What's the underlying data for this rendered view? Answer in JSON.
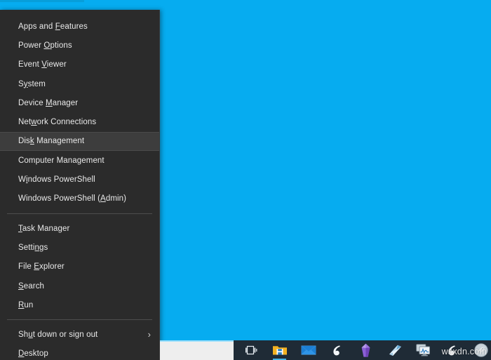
{
  "desktop": {
    "background_color": "#06acf0"
  },
  "winx_menu": {
    "name": "Win+X Power User Menu",
    "background_color": "#2b2b2b",
    "highlight_color": "#3d3d3d",
    "text_color": "#e9e9e9",
    "groups": [
      {
        "items": [
          {
            "label": "Apps and Features",
            "accel": "F",
            "highlighted": false,
            "submenu": false
          },
          {
            "label": "Power Options",
            "accel": "O",
            "highlighted": false,
            "submenu": false
          },
          {
            "label": "Event Viewer",
            "accel": "V",
            "highlighted": false,
            "submenu": false
          },
          {
            "label": "System",
            "accel": "y",
            "highlighted": false,
            "submenu": false
          },
          {
            "label": "Device Manager",
            "accel": "M",
            "highlighted": false,
            "submenu": false
          },
          {
            "label": "Network Connections",
            "accel": "w",
            "highlighted": false,
            "submenu": false
          },
          {
            "label": "Disk Management",
            "accel": "k",
            "highlighted": true,
            "submenu": false
          },
          {
            "label": "Computer Management",
            "accel": "g",
            "highlighted": false,
            "submenu": false
          },
          {
            "label": "Windows PowerShell",
            "accel": "i",
            "highlighted": false,
            "submenu": false
          },
          {
            "label": "Windows PowerShell (Admin)",
            "accel": "A",
            "highlighted": false,
            "submenu": false
          }
        ]
      },
      {
        "items": [
          {
            "label": "Task Manager",
            "accel": "T",
            "highlighted": false,
            "submenu": false
          },
          {
            "label": "Settings",
            "accel": "n",
            "highlighted": false,
            "submenu": false
          },
          {
            "label": "File Explorer",
            "accel": "E",
            "highlighted": false,
            "submenu": false
          },
          {
            "label": "Search",
            "accel": "S",
            "highlighted": false,
            "submenu": false
          },
          {
            "label": "Run",
            "accel": "R",
            "highlighted": false,
            "submenu": false
          }
        ]
      },
      {
        "items": [
          {
            "label": "Shut down or sign out",
            "accel": "u",
            "highlighted": false,
            "submenu": true,
            "submenu_glyph": "›"
          },
          {
            "label": "Desktop",
            "accel": "D",
            "highlighted": false,
            "submenu": false
          }
        ]
      }
    ]
  },
  "taskbar": {
    "background_color": "#1f2b36",
    "search_box": {
      "name": "search-box",
      "value": "",
      "placeholder": "",
      "background_color": "#eeeeee",
      "accent_color": "#9fe0fb"
    },
    "icons": [
      {
        "name": "task-view-icon",
        "title": "Task View",
        "active": false
      },
      {
        "name": "file-explorer-icon",
        "title": "File Explorer",
        "active": true
      },
      {
        "name": "mail-icon",
        "title": "Mail",
        "active": false
      },
      {
        "name": "sogou-input-icon",
        "title": "Sogou",
        "active": false
      },
      {
        "name": "crystal-gem-icon",
        "title": "Gem App",
        "active": false
      },
      {
        "name": "document-viewer-icon",
        "title": "Document Viewer",
        "active": false
      },
      {
        "name": "system-monitor-icon",
        "title": "System Monitor",
        "active": false
      },
      {
        "name": "sogou-pinyin-icon",
        "title": "Sogou Pinyin",
        "active": false
      },
      {
        "name": "leaf-disc-icon",
        "title": "Utility",
        "active": false
      }
    ]
  },
  "watermark": {
    "text": "wsxdn.com"
  }
}
